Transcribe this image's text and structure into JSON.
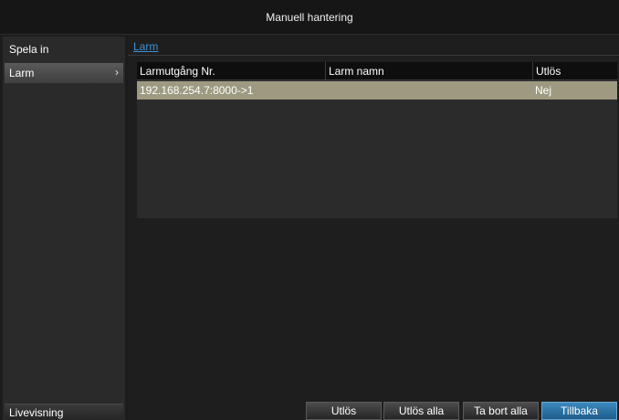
{
  "window": {
    "title": "Manuell hantering"
  },
  "sidebar": {
    "items": [
      {
        "label": "Spela in",
        "active": false
      },
      {
        "label": "Larm",
        "active": true,
        "chevron": "›"
      }
    ],
    "bottom_label": "Livevisning"
  },
  "main": {
    "breadcrumb": "Larm",
    "table": {
      "columns": [
        "Larmutgång Nr.",
        "Larm namn",
        "Utlös"
      ],
      "rows": [
        {
          "output": "192.168.254.7:8000->1",
          "name": "",
          "trigger": "Nej"
        }
      ]
    }
  },
  "buttons": {
    "trigger": "Utlös",
    "trigger_all": "Utlös alla",
    "clear_all": "Ta bort alla",
    "back": "Tillbaka"
  },
  "colors": {
    "selected_row": "#9d9a81",
    "link": "#3e93d8",
    "primary_button": "#2f78ad"
  }
}
